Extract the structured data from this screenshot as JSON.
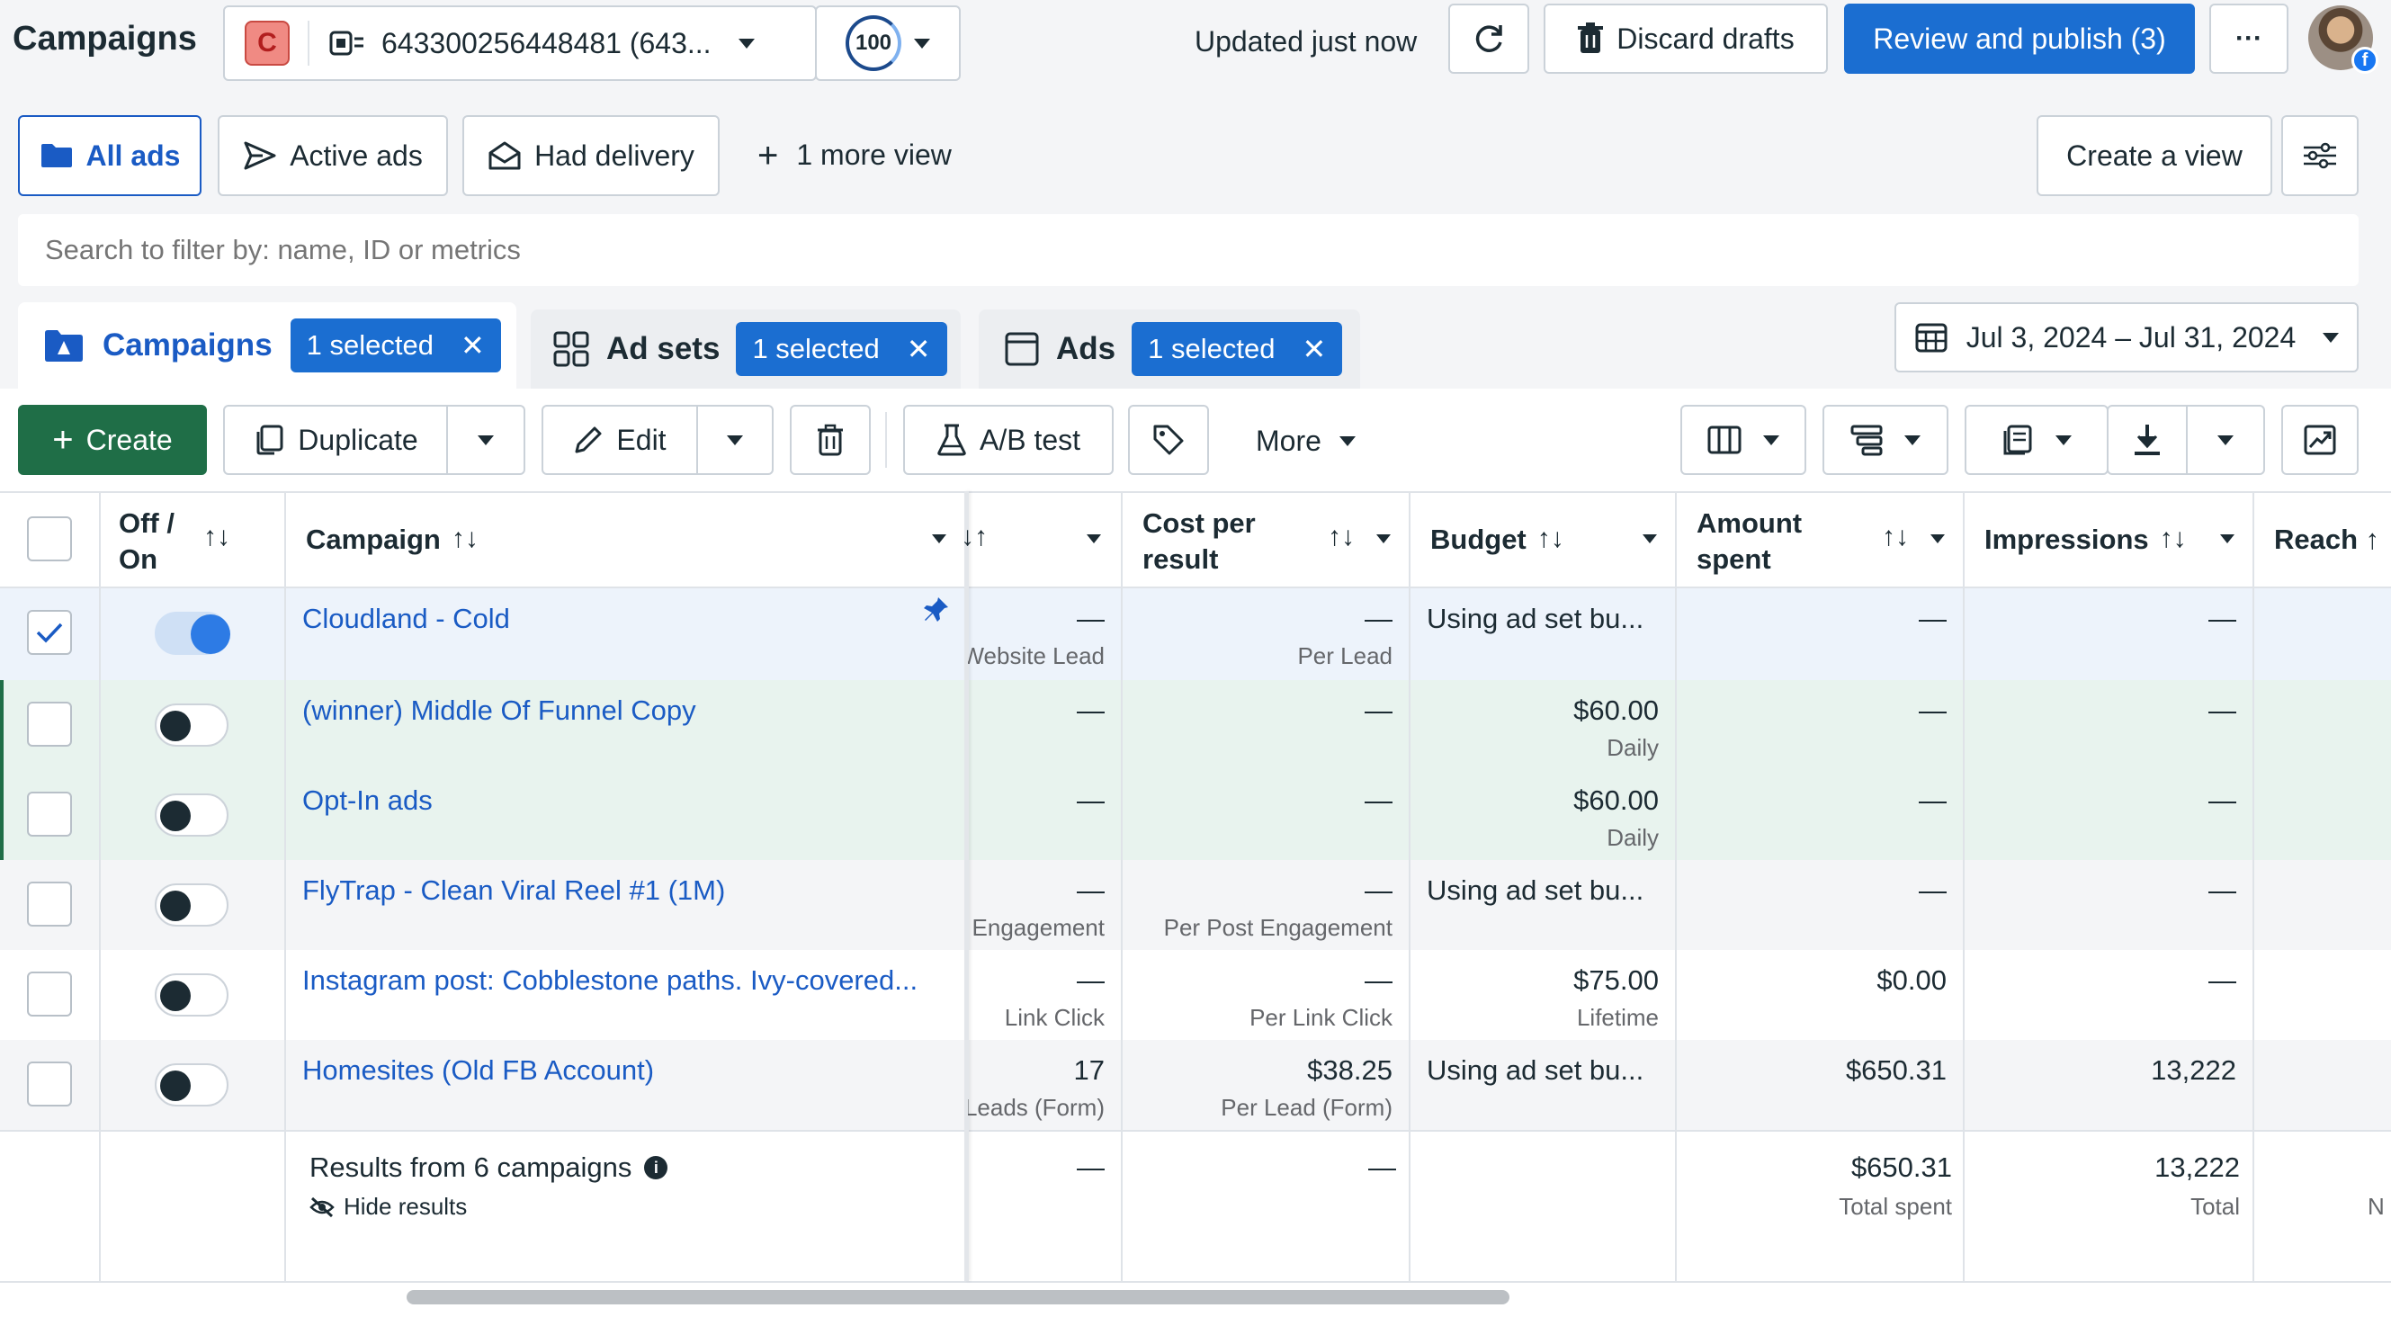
{
  "header": {
    "title": "Campaigns",
    "account_letter": "C",
    "account_id": "643300256448481 (643...",
    "score": "100",
    "updated": "Updated just now",
    "discard_label": "Discard drafts",
    "publish_label": "Review and publish (3)",
    "more_label": "···"
  },
  "views": {
    "all_ads": "All ads",
    "active_ads": "Active ads",
    "had_delivery": "Had delivery",
    "more_view": "1 more view",
    "create_view": "Create a view"
  },
  "search": {
    "placeholder": "Search to filter by: name, ID or metrics"
  },
  "levels": {
    "campaigns": "Campaigns",
    "campaigns_badge": "1 selected",
    "adsets": "Ad sets",
    "adsets_badge": "1 selected",
    "ads": "Ads",
    "ads_badge": "1 selected"
  },
  "date_range": "Jul 3, 2024 – Jul 31, 2024",
  "toolbar": {
    "create": "Create",
    "duplicate": "Duplicate",
    "edit": "Edit",
    "ab_test": "A/B test",
    "more": "More"
  },
  "table": {
    "headers": {
      "off_on_1": "Off /",
      "off_on_2": "On",
      "campaign": "Campaign",
      "results_sort": "↑↓",
      "cost_per_result_1": "Cost per",
      "cost_per_result_2": "result",
      "budget": "Budget",
      "amount_spent_1": "Amount",
      "amount_spent_2": "spent",
      "impressions": "Impressions",
      "reach": "Reach ↑"
    },
    "rows": [
      {
        "name": "Cloudland - Cold",
        "results": "—",
        "results_sub": "Website Lead",
        "cpr": "—",
        "cpr_sub": "Per Lead",
        "budget": "Using ad set bu...",
        "budget_sub": "",
        "spent": "—",
        "impressions": "—",
        "selected": true,
        "on": true
      },
      {
        "name": "(winner) Middle Of Funnel Copy",
        "results": "—",
        "results_sub": "",
        "cpr": "—",
        "cpr_sub": "",
        "budget": "$60.00",
        "budget_sub": "Daily",
        "spent": "—",
        "impressions": "—",
        "selected": false,
        "on": false
      },
      {
        "name": "Opt-In ads",
        "results": "—",
        "results_sub": "",
        "cpr": "—",
        "cpr_sub": "",
        "budget": "$60.00",
        "budget_sub": "Daily",
        "spent": "—",
        "impressions": "—",
        "selected": false,
        "on": false
      },
      {
        "name": "FlyTrap - Clean Viral Reel #1 (1M)",
        "results": "—",
        "results_sub": "Engagement",
        "cpr": "—",
        "cpr_sub": "Per Post Engagement",
        "budget": "Using ad set bu...",
        "budget_sub": "",
        "spent": "—",
        "impressions": "—",
        "selected": false,
        "on": false
      },
      {
        "name": "Instagram post: Cobblestone paths. Ivy-covered...",
        "results": "—",
        "results_sub": "Link Click",
        "cpr": "—",
        "cpr_sub": "Per Link Click",
        "budget": "$75.00",
        "budget_sub": "Lifetime",
        "spent": "$0.00",
        "impressions": "—",
        "selected": false,
        "on": false
      },
      {
        "name": "Homesites (Old FB Account)",
        "results": "17",
        "results_sub": "Leads (Form)",
        "cpr": "$38.25",
        "cpr_sub": "Per Lead (Form)",
        "budget": "Using ad set bu...",
        "budget_sub": "",
        "spent": "$650.31",
        "impressions": "13,222",
        "selected": false,
        "on": false
      }
    ],
    "footer": {
      "label": "Results from 6 campaigns",
      "hide": "Hide results",
      "results": "—",
      "cpr": "—",
      "spent": "$650.31",
      "spent_sub": "Total spent",
      "impressions": "13,222",
      "impressions_sub": "Total",
      "reach_sub": "N"
    }
  },
  "colors": {
    "accent": "#1a5bc4",
    "publish": "#1b6ed1",
    "create": "#1f6e47",
    "selected_row": "#edf3fb",
    "green_row": "#e8f3ee"
  }
}
